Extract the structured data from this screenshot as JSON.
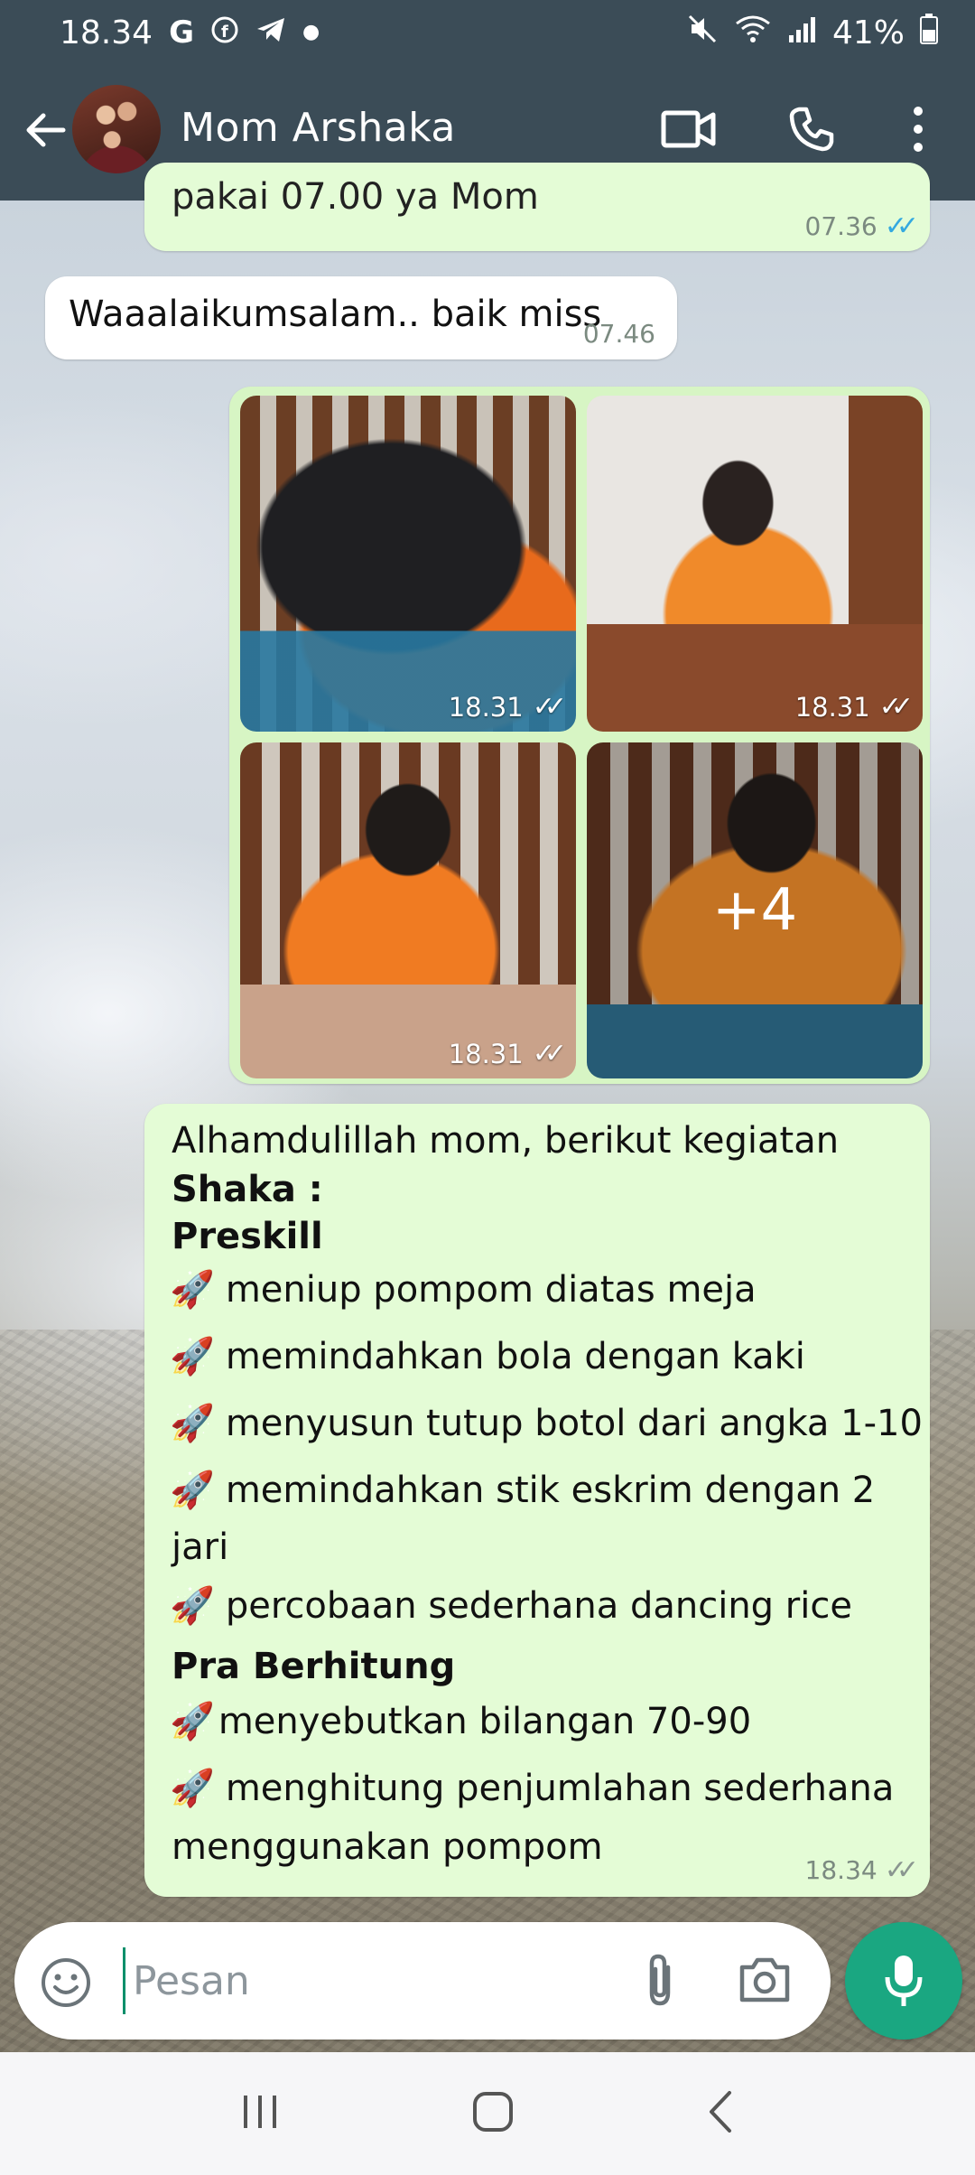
{
  "status_bar": {
    "time": "18.34",
    "battery": "41%"
  },
  "header": {
    "contact_name": "Mom Arshaka"
  },
  "messages": {
    "m1": {
      "text": "pakai 07.00 ya Mom",
      "time": "07.36"
    },
    "m2": {
      "text": "Waaalaikumsalam.. baik miss",
      "time": "07.46"
    },
    "photos": [
      {
        "time": "18.31"
      },
      {
        "time": "18.31"
      },
      {
        "time": "18.31"
      },
      {
        "more": "+4"
      }
    ],
    "m4": {
      "intro": "Alhamdulillah mom, berikut kegiatan",
      "name": "Shaka :",
      "section1": "Preskill",
      "items1": [
        "meniup pompom diatas meja",
        "memindahkan bola dengan kaki",
        "menyusun tutup botol dari angka 1-10",
        "memindahkan stik eskrim dengan 2",
        "jari",
        "percobaan sederhana dancing rice"
      ],
      "section2": "Pra Berhitung",
      "items2": [
        "menyebutkan bilangan 70-90",
        "menghitung penjumlahan sederhana",
        "menggunakan pompom"
      ],
      "time": "18.34"
    }
  },
  "input": {
    "placeholder": "Pesan"
  },
  "colors": {
    "header_bg": "#3b4c57",
    "outgoing_bubble": "#e4fcd6",
    "incoming_bubble": "#ffffff",
    "accent": "#1aa781",
    "read_tick": "#34a9e0"
  },
  "icons": {
    "rocket": "🚀"
  }
}
